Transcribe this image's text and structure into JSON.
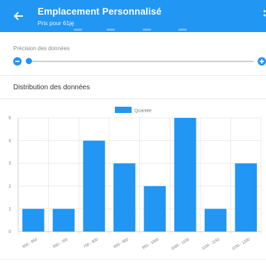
{
  "appbar": {
    "title": "Emplacement Personnalisé",
    "subtitle": "Prix pour 61ję",
    "color": "#2196f3"
  },
  "precision": {
    "label": "Précision des données",
    "value": 0.0
  },
  "distribution": {
    "label": "Distribution des données"
  },
  "chart_data": {
    "type": "bar",
    "legend": [
      "Quantité"
    ],
    "legend_position": "top-center",
    "color": "#2196f3",
    "categories": [
      "600 - 650",
      "650 - 700",
      "700 - 800",
      "800 - 900",
      "950 - 1000",
      "1000 - 1100",
      "1100 - 1150",
      "1150 - 1200"
    ],
    "series": [
      {
        "name": "Quantité",
        "values": [
          1,
          1,
          4,
          3,
          2,
          5,
          1,
          3
        ]
      }
    ],
    "yticks": [
      "0",
      "1",
      "2",
      "3",
      "4",
      "5"
    ],
    "ylim": [
      0,
      5
    ],
    "grid": true
  }
}
